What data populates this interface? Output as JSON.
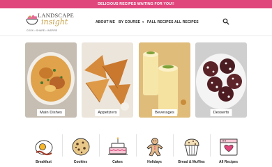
{
  "promo": {
    "text": "DELICIOUS RECIPES WAITING FOR YOU!!"
  },
  "brand": {
    "word1": "LANDSCAPE",
    "word2": "insight",
    "tagline": "COOK • SHARE • INSPIRE",
    "accent": "#e0457b",
    "gold": "#c8a24a"
  },
  "nav": {
    "about": "ABOUT ME",
    "course": "BY COURSE",
    "fall": "FALL RECIPES",
    "all": "ALL RECIPES"
  },
  "categories": [
    {
      "label": "Main Dishes"
    },
    {
      "label": "Appetizers"
    },
    {
      "label": "Beverages"
    },
    {
      "label": "Desserts"
    }
  ],
  "icon_categories": [
    {
      "label": "Breakfast",
      "icon": "egg-bacon-icon"
    },
    {
      "label": "Cookies",
      "icon": "cookie-icon"
    },
    {
      "label": "Cakes",
      "icon": "cake-icon"
    },
    {
      "label": "Holidays",
      "icon": "gingerbread-icon"
    },
    {
      "label": "Bread & Muffins",
      "icon": "muffin-icon"
    },
    {
      "label": "All Recipes",
      "icon": "recipe-book-icon"
    }
  ]
}
